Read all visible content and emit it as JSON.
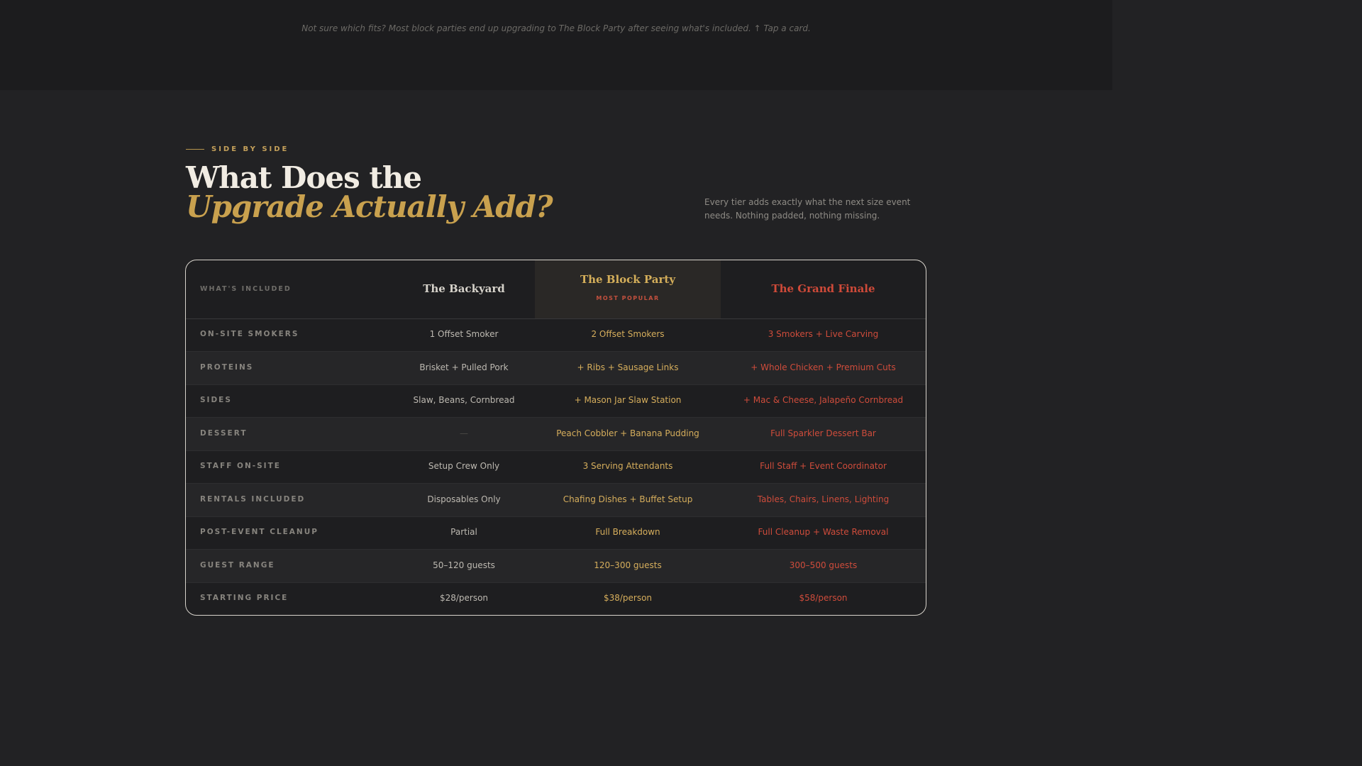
{
  "top_note": "Not sure which fits? Most block parties end up upgrading to The Block Party after seeing what's included. ↑ Tap a card.",
  "section": {
    "eyebrow": "SIDE BY SIDE",
    "title_line1": "What Does the",
    "title_line2": "Upgrade Actually Add?",
    "subtitle": "Every tier adds exactly what the next size event needs. Nothing padded, nothing missing."
  },
  "table": {
    "header_label": "WHAT'S INCLUDED",
    "tiers": [
      {
        "name": "The Backyard"
      },
      {
        "name": "The Block Party",
        "badge": "MOST POPULAR"
      },
      {
        "name": "The Grand Finale"
      }
    ],
    "rows": [
      {
        "label": "ON-SITE SMOKERS",
        "a": "1 Offset Smoker",
        "b": "2 Offset Smokers",
        "c": "3 Smokers + Live Carving"
      },
      {
        "label": "PROTEINS",
        "a": "Brisket + Pulled Pork",
        "b": "+ Ribs + Sausage Links",
        "c": "+ Whole Chicken + Premium Cuts"
      },
      {
        "label": "SIDES",
        "a": "Slaw, Beans, Cornbread",
        "b": "+ Mason Jar Slaw Station",
        "c": "+ Mac & Cheese, Jalapeño Cornbread"
      },
      {
        "label": "DESSERT",
        "a": "—",
        "b": "Peach Cobbler + Banana Pudding",
        "c": "Full Sparkler Dessert Bar"
      },
      {
        "label": "STAFF ON-SITE",
        "a": "Setup Crew Only",
        "b": "3 Serving Attendants",
        "c": "Full Staff + Event Coordinator"
      },
      {
        "label": "RENTALS INCLUDED",
        "a": "Disposables Only",
        "b": "Chafing Dishes + Buffet Setup",
        "c": "Tables, Chairs, Linens, Lighting"
      },
      {
        "label": "POST-EVENT CLEANUP",
        "a": "Partial",
        "b": "Full Breakdown",
        "c": "Full Cleanup + Waste Removal"
      },
      {
        "label": "GUEST RANGE",
        "a": "50–120 guests",
        "b": "120–300 guests",
        "c": "300–500 guests"
      },
      {
        "label": "STARTING PRICE",
        "a": "$28/person",
        "b": "$38/person",
        "c": "$58/person"
      }
    ]
  },
  "colors": {
    "gold": "#c9a14e",
    "red": "#cf4a39",
    "background": "#222224"
  }
}
